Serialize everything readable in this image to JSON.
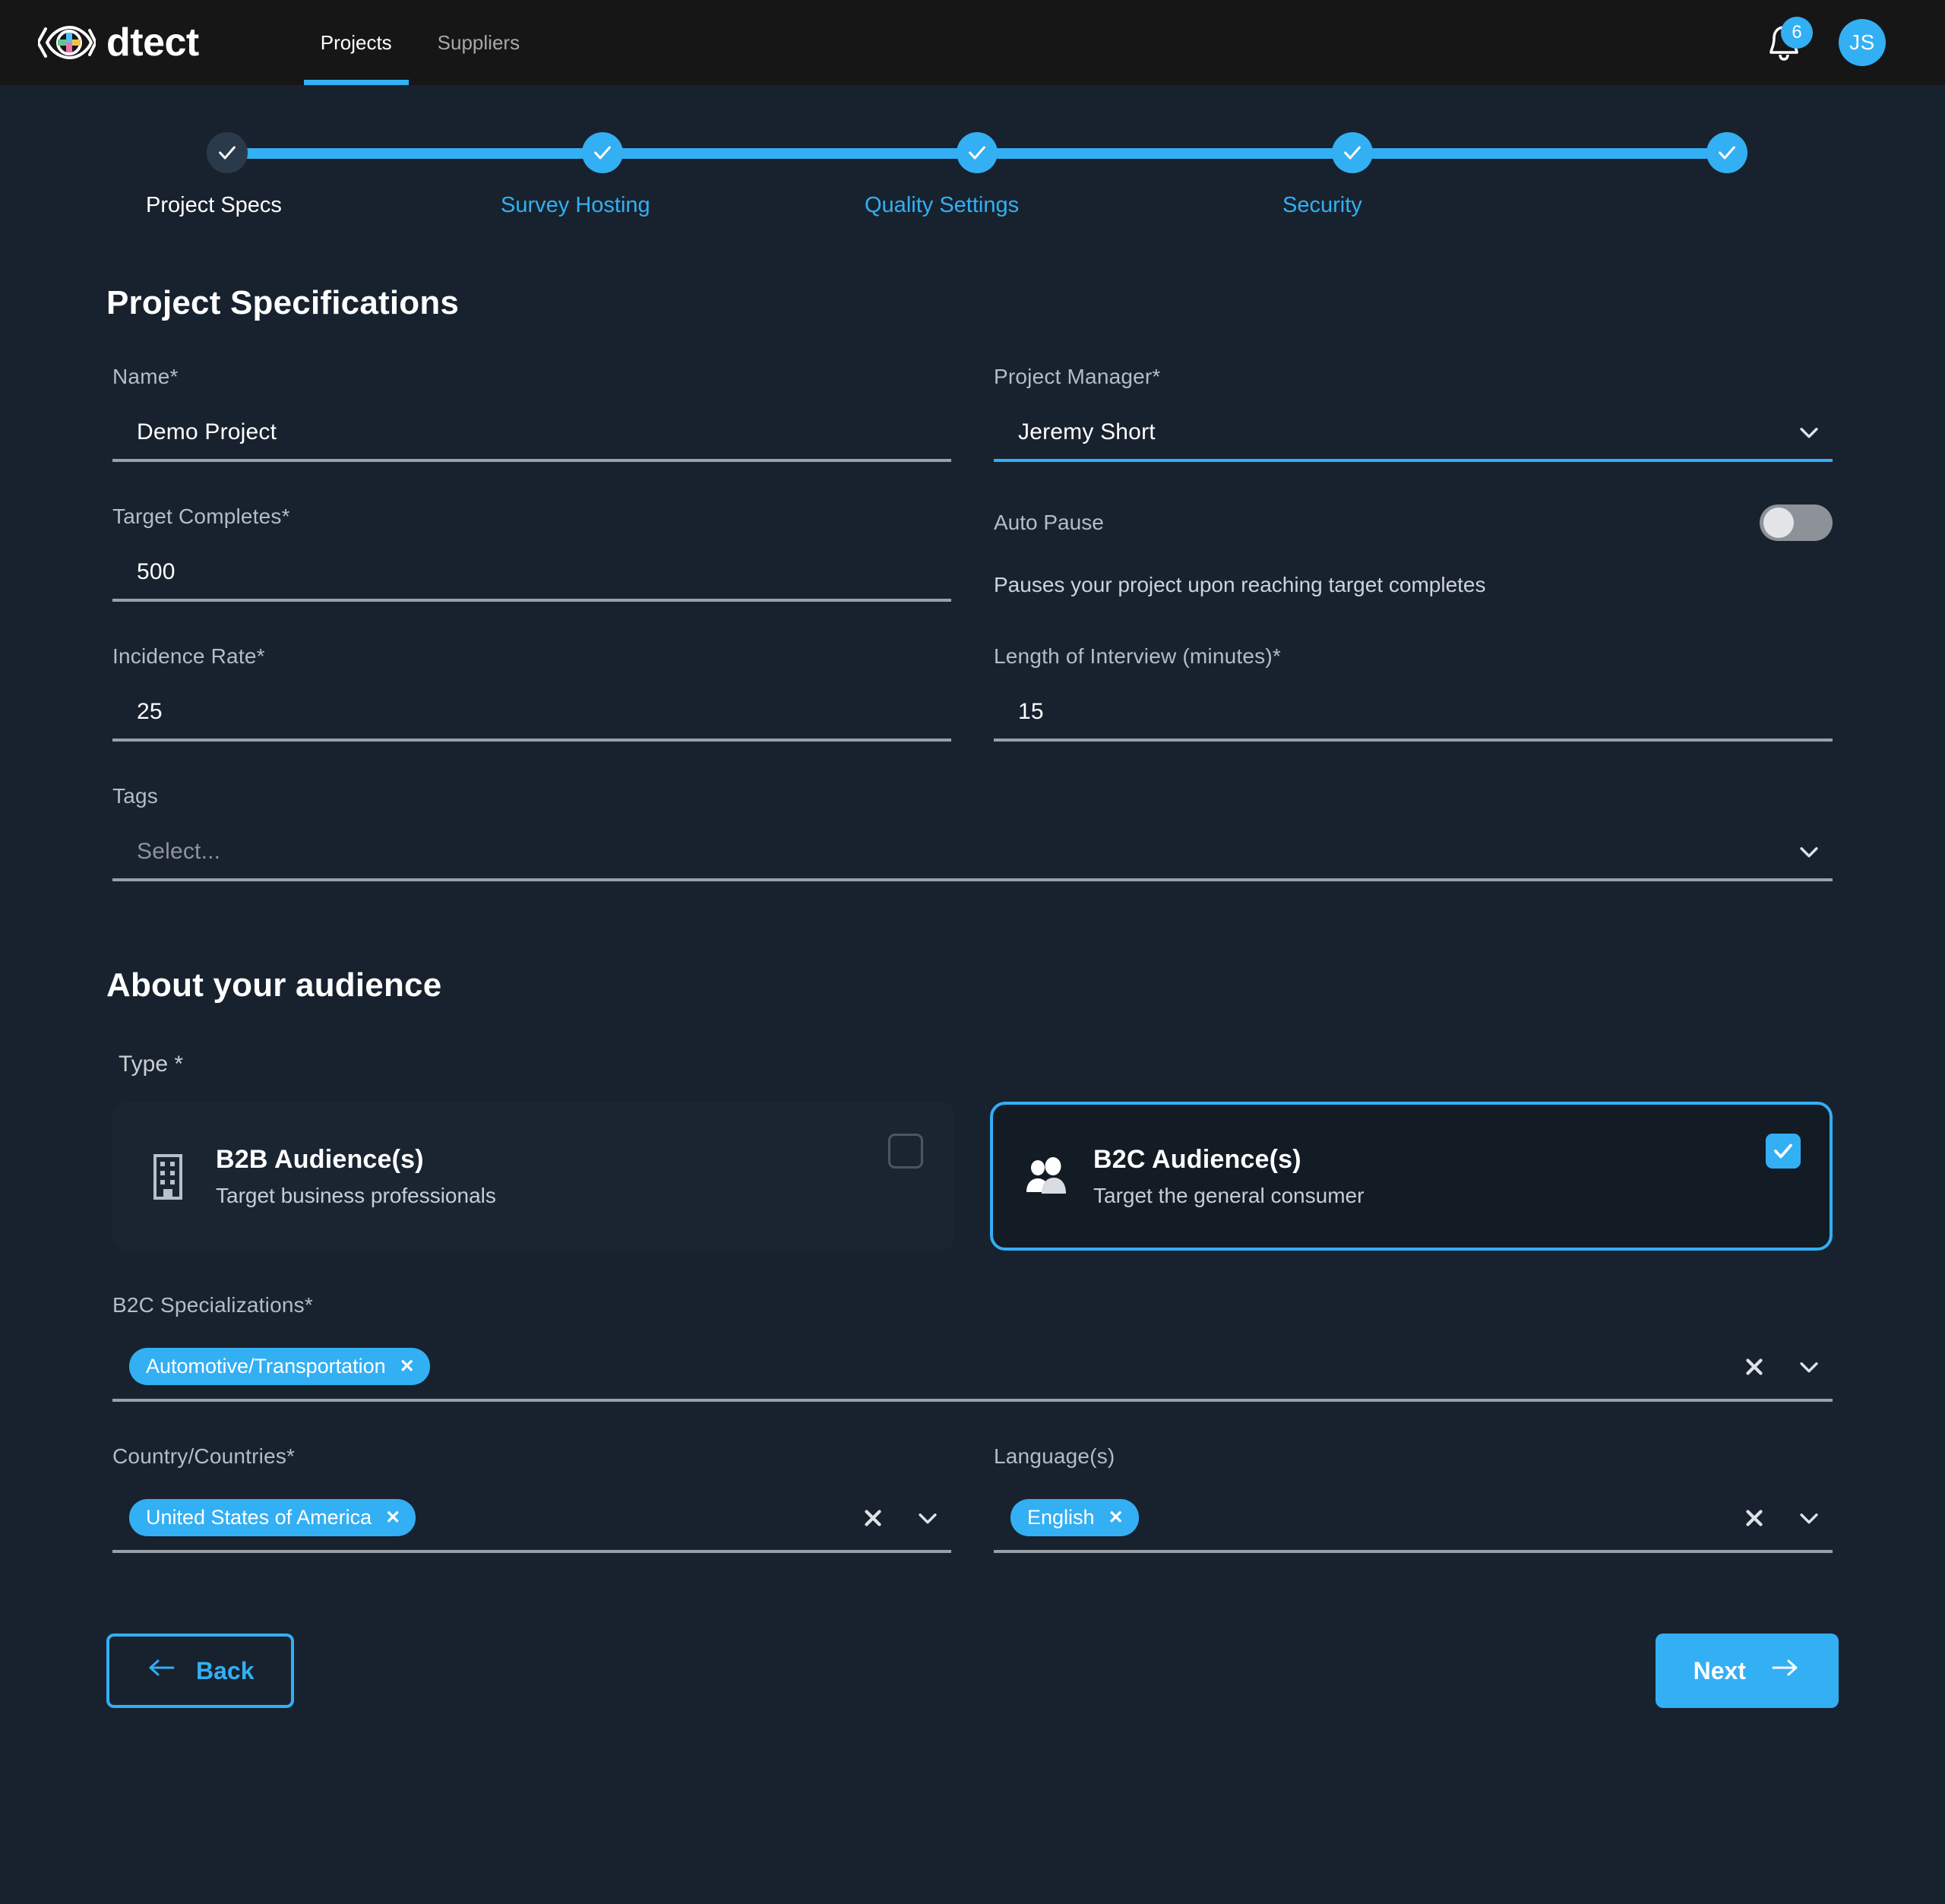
{
  "header": {
    "brand": "dtect",
    "nav": [
      {
        "label": "Projects",
        "active": true
      },
      {
        "label": "Suppliers",
        "active": false
      }
    ],
    "notification_count": "6",
    "avatar_initials": "JS"
  },
  "stepper": {
    "steps": [
      {
        "label": "Project Specs",
        "state": "current"
      },
      {
        "label": "Survey Hosting",
        "state": "complete"
      },
      {
        "label": "Quality Settings",
        "state": "complete"
      },
      {
        "label": "Security",
        "state": "complete"
      },
      {
        "label": "",
        "state": "complete"
      }
    ]
  },
  "specs": {
    "title": "Project Specifications",
    "name": {
      "label": "Name*",
      "value": "Demo Project"
    },
    "project_manager": {
      "label": "Project Manager*",
      "value": "Jeremy Short"
    },
    "target_completes": {
      "label": "Target Completes*",
      "value": "500"
    },
    "auto_pause": {
      "label": "Auto Pause",
      "description": "Pauses your project upon reaching target completes",
      "state": "off"
    },
    "incidence_rate": {
      "label": "Incidence Rate*",
      "value": "25"
    },
    "length_of_interview": {
      "label": "Length of Interview (minutes)*",
      "value": "15"
    },
    "tags": {
      "label": "Tags",
      "placeholder": "Select..."
    }
  },
  "audience": {
    "title": "About your audience",
    "type_label": "Type *",
    "cards": [
      {
        "title": "B2B Audience(s)",
        "subtitle": "Target business professionals",
        "icon": "building-icon",
        "selected": false
      },
      {
        "title": "B2C Audience(s)",
        "subtitle": "Target the general consumer",
        "icon": "people-icon",
        "selected": true
      }
    ],
    "specializations": {
      "label": "B2C Specializations*",
      "chips": [
        "Automotive/Transportation"
      ]
    },
    "countries": {
      "label": "Country/Countries*",
      "chips": [
        "United States of America"
      ]
    },
    "languages": {
      "label": "Language(s)",
      "chips": [
        "English"
      ]
    }
  },
  "footer": {
    "back_label": "Back",
    "next_label": "Next"
  },
  "colors": {
    "accent": "#33aff4",
    "page_bg": "#18222e",
    "topbar_bg": "#161616",
    "card_bg": "#1b2532"
  }
}
